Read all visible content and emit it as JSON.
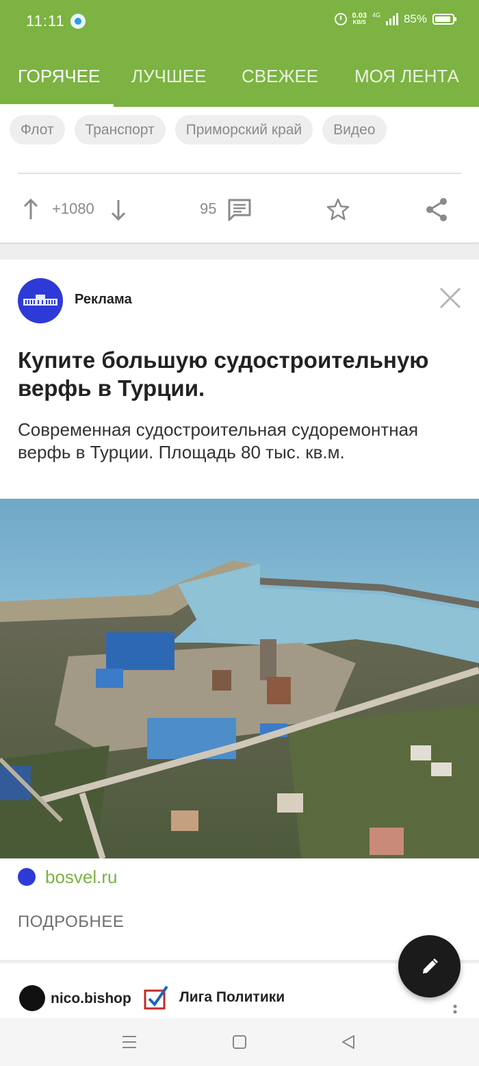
{
  "status_bar": {
    "time": "11:11",
    "net_speed_value": "0.03",
    "net_speed_unit": "KB/S",
    "network_gen": "4G",
    "battery": "85%"
  },
  "tabs": [
    {
      "label": "ГОРЯЧЕЕ",
      "active": true
    },
    {
      "label": "ЛУЧШЕЕ",
      "active": false
    },
    {
      "label": "СВЕЖЕЕ",
      "active": false
    },
    {
      "label": "МОЯ ЛЕНТА",
      "active": false
    }
  ],
  "post": {
    "tags": [
      "Флот",
      "Транспорт",
      "Приморский край",
      "Видео"
    ],
    "rating": "+1080",
    "comments_count": "95"
  },
  "ad": {
    "label": "Реклама",
    "title": "Купите большую судостроительную верфь в Турции.",
    "description": "Современная судостроительная судоремонтная верфь в Турции. Площадь 80 тыс. кв.м.",
    "site": "bosvel.ru",
    "more_label": "ПОДРОБНЕЕ"
  },
  "next_post": {
    "author": "nico.bishop",
    "community": "Лига Политики"
  },
  "colors": {
    "accent": "#7cb342",
    "fab": "#1b1b1b",
    "ad_avatar": "#2d3ad8"
  }
}
